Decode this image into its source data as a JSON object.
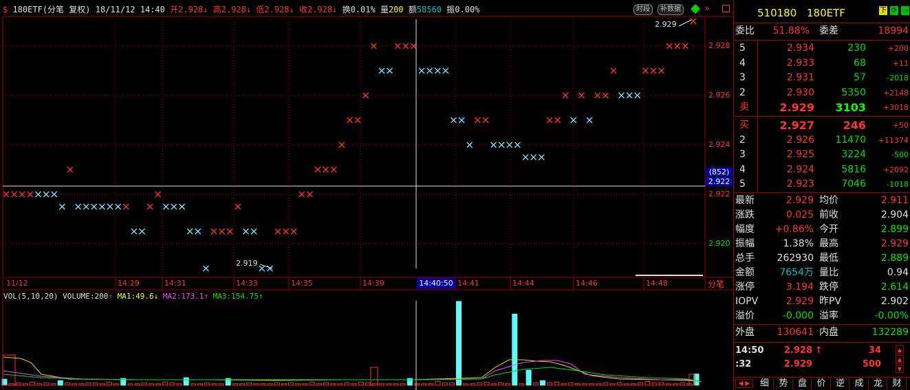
{
  "header": {
    "symbol_name": "180ETF(分笔 复权)",
    "datetime": "18/11/12 14:40",
    "open_label": "开",
    "open_value": "2.928",
    "high_label": "高",
    "high_value": "2.928",
    "low_label": "低",
    "low_value": "2.928",
    "close_label": "收",
    "close_value": "2.928",
    "turnover_label": "换",
    "turnover_value": "0.01%",
    "volume_label": "量",
    "volume_value": "200",
    "amount_label": "额",
    "amount_value": "58560",
    "amplitude_label": "振",
    "amplitude_value": "0.00%",
    "btn_timeshare": "时段",
    "btn_supplement": "补数据"
  },
  "price_axis": [
    "2.928",
    "2.926",
    "2.924",
    "2.922",
    "2.920"
  ],
  "crosshair": {
    "count_label": "(852)",
    "price_label": "2.922",
    "time_label": "14:40:50"
  },
  "annotations": {
    "high_label": "2.929",
    "low_label": "2.919"
  },
  "time_axis": [
    "11/12",
    "14:29",
    "14:31",
    "14:33",
    "14:35",
    "14:39",
    "14:41",
    "14:44",
    "14:46",
    "14:48"
  ],
  "tab_fenbi": "分笔",
  "volume_header": {
    "title": "VOL(5,10,20)",
    "volume": "VOLUME:200",
    "ma1": "MA1:49.6",
    "ma2": "MA2:173.1",
    "ma3": "MA3:154.75"
  },
  "colors": {
    "up": "#ff3232",
    "down": "#00e600",
    "cross_up": "#ff3232",
    "cross_down": "#80e0ff",
    "grid": "#a00000",
    "volume_bar": "#54ffff"
  },
  "ticks": [
    {
      "p": 2.922,
      "d": "u"
    },
    {
      "p": 2.922,
      "d": "u"
    },
    {
      "p": 2.922,
      "d": "u"
    },
    {
      "p": 2.922,
      "d": "u"
    },
    {
      "p": 2.922,
      "d": "d"
    },
    {
      "p": 2.922,
      "d": "d"
    },
    {
      "p": 2.922,
      "d": "d"
    },
    {
      "p": 2.9215,
      "d": "d"
    },
    {
      "p": 2.923,
      "d": "u"
    },
    {
      "p": 2.9215,
      "d": "d"
    },
    {
      "p": 2.9215,
      "d": "d"
    },
    {
      "p": 2.9215,
      "d": "d"
    },
    {
      "p": 2.9215,
      "d": "d"
    },
    {
      "p": 2.9215,
      "d": "d"
    },
    {
      "p": 2.9215,
      "d": "d"
    },
    {
      "p": 2.9215,
      "d": "u"
    },
    {
      "p": 2.9205,
      "d": "d"
    },
    {
      "p": 2.9205,
      "d": "d"
    },
    {
      "p": 2.9215,
      "d": "u"
    },
    {
      "p": 2.922,
      "d": "u"
    },
    {
      "p": 2.9215,
      "d": "d"
    },
    {
      "p": 2.9215,
      "d": "d"
    },
    {
      "p": 2.9215,
      "d": "d"
    },
    {
      "p": 2.9205,
      "d": "d"
    },
    {
      "p": 2.9205,
      "d": "d"
    },
    {
      "p": 2.919,
      "d": "d"
    },
    {
      "p": 2.9205,
      "d": "u"
    },
    {
      "p": 2.9205,
      "d": "u"
    },
    {
      "p": 2.9205,
      "d": "u"
    },
    {
      "p": 2.9215,
      "d": "u"
    },
    {
      "p": 2.9205,
      "d": "d"
    },
    {
      "p": 2.9205,
      "d": "d"
    },
    {
      "p": 2.919,
      "d": "d"
    },
    {
      "p": 2.919,
      "d": "d"
    },
    {
      "p": 2.9205,
      "d": "u"
    },
    {
      "p": 2.9205,
      "d": "u"
    },
    {
      "p": 2.9205,
      "d": "u"
    },
    {
      "p": 2.922,
      "d": "u"
    },
    {
      "p": 2.922,
      "d": "u"
    },
    {
      "p": 2.923,
      "d": "u"
    },
    {
      "p": 2.923,
      "d": "u"
    },
    {
      "p": 2.923,
      "d": "u"
    },
    {
      "p": 2.924,
      "d": "u"
    },
    {
      "p": 2.925,
      "d": "u"
    },
    {
      "p": 2.925,
      "d": "u"
    },
    {
      "p": 2.926,
      "d": "u"
    },
    {
      "p": 2.928,
      "d": "u"
    },
    {
      "p": 2.927,
      "d": "d"
    },
    {
      "p": 2.927,
      "d": "d"
    },
    {
      "p": 2.928,
      "d": "u"
    },
    {
      "p": 2.928,
      "d": "u"
    },
    {
      "p": 2.928,
      "d": "u"
    },
    {
      "p": 2.927,
      "d": "d"
    },
    {
      "p": 2.927,
      "d": "d"
    },
    {
      "p": 2.927,
      "d": "d"
    },
    {
      "p": 2.927,
      "d": "d"
    },
    {
      "p": 2.925,
      "d": "d"
    },
    {
      "p": 2.925,
      "d": "d"
    },
    {
      "p": 2.924,
      "d": "d"
    },
    {
      "p": 2.925,
      "d": "u"
    },
    {
      "p": 2.925,
      "d": "u"
    },
    {
      "p": 2.924,
      "d": "d"
    },
    {
      "p": 2.924,
      "d": "d"
    },
    {
      "p": 2.924,
      "d": "d"
    },
    {
      "p": 2.924,
      "d": "d"
    },
    {
      "p": 2.9235,
      "d": "d"
    },
    {
      "p": 2.9235,
      "d": "d"
    },
    {
      "p": 2.9235,
      "d": "d"
    },
    {
      "p": 2.925,
      "d": "u"
    },
    {
      "p": 2.925,
      "d": "u"
    },
    {
      "p": 2.926,
      "d": "u"
    },
    {
      "p": 2.925,
      "d": "d"
    },
    {
      "p": 2.926,
      "d": "u"
    },
    {
      "p": 2.925,
      "d": "d"
    },
    {
      "p": 2.926,
      "d": "u"
    },
    {
      "p": 2.926,
      "d": "u"
    },
    {
      "p": 2.927,
      "d": "u"
    },
    {
      "p": 2.926,
      "d": "d"
    },
    {
      "p": 2.926,
      "d": "d"
    },
    {
      "p": 2.926,
      "d": "d"
    },
    {
      "p": 2.927,
      "d": "u"
    },
    {
      "p": 2.927,
      "d": "u"
    },
    {
      "p": 2.927,
      "d": "u"
    },
    {
      "p": 2.928,
      "d": "u"
    },
    {
      "p": 2.928,
      "d": "u"
    },
    {
      "p": 2.928,
      "d": "u"
    },
    {
      "p": 2.929,
      "d": "u"
    }
  ],
  "volume_bars": [
    8,
    2,
    3,
    2,
    4,
    2,
    3,
    2,
    6,
    3,
    2,
    2,
    3,
    3,
    2,
    4,
    2,
    9,
    2,
    2,
    3,
    2,
    2,
    4,
    3,
    2,
    10,
    2,
    2,
    3,
    2,
    2,
    9,
    2,
    2,
    3,
    2,
    2,
    2,
    3,
    2,
    3,
    2,
    2,
    4,
    2,
    3,
    2,
    2,
    3,
    2,
    4,
    3,
    2,
    2,
    2,
    2,
    2,
    9,
    2,
    2,
    2,
    5,
    3,
    3,
    112,
    2,
    2,
    3,
    4,
    2,
    3,
    2,
    95,
    2,
    20,
    3,
    6,
    3,
    4,
    2,
    3,
    2,
    2,
    2,
    2,
    3,
    2,
    3,
    2,
    2,
    3,
    5,
    3,
    3,
    2,
    2,
    3,
    2,
    15
  ],
  "quote": {
    "code": "510180",
    "name": "180ETF",
    "weibi_label": "委比",
    "weibi_value": "51.88%",
    "weicha_label": "委差",
    "weicha_value": "18994",
    "asks": [
      {
        "lvl": "5",
        "price": "2.934",
        "vol": "230",
        "chg": "+200"
      },
      {
        "lvl": "4",
        "price": "2.933",
        "vol": "68",
        "chg": "+11"
      },
      {
        "lvl": "3",
        "price": "2.931",
        "vol": "57",
        "chg": "-2018"
      },
      {
        "lvl": "2",
        "price": "2.930",
        "vol": "5350",
        "chg": "+2148"
      },
      {
        "lvl": "卖",
        "price": "2.929",
        "vol": "3103",
        "chg": "+3018"
      }
    ],
    "bids": [
      {
        "lvl": "买",
        "price": "2.927",
        "vol": "246",
        "chg": "+50"
      },
      {
        "lvl": "2",
        "price": "2.926",
        "vol": "11470",
        "chg": "+11374"
      },
      {
        "lvl": "3",
        "price": "2.925",
        "vol": "3224",
        "chg": "-500"
      },
      {
        "lvl": "4",
        "price": "2.924",
        "vol": "5816",
        "chg": "+2092"
      },
      {
        "lvl": "5",
        "price": "2.923",
        "vol": "7046",
        "chg": "-1018"
      }
    ],
    "stats": [
      {
        "l1": "最新",
        "v1": "2.929",
        "c1": "up",
        "l2": "均价",
        "v2": "2.911",
        "c2": "up"
      },
      {
        "l1": "涨跌",
        "v1": "0.025",
        "c1": "up",
        "l2": "前收",
        "v2": "2.904",
        "c2": "wh"
      },
      {
        "l1": "幅度",
        "v1": "+0.86%",
        "c1": "up",
        "l2": "今开",
        "v2": "2.899",
        "c2": "dn"
      },
      {
        "l1": "振幅",
        "v1": "1.38%",
        "c1": "wh",
        "l2": "最高",
        "v2": "2.929",
        "c2": "up"
      },
      {
        "l1": "总手",
        "v1": "262930",
        "c1": "wh",
        "l2": "最低",
        "v2": "2.889",
        "c2": "dn"
      },
      {
        "l1": "金额",
        "v1": "7654万",
        "c1": "cy",
        "l2": "量比",
        "v2": "0.94",
        "c2": "wh"
      },
      {
        "l1": "涨停",
        "v1": "3.194",
        "c1": "up",
        "l2": "跌停",
        "v2": "2.614",
        "c2": "dn"
      },
      {
        "l1": "IOPV",
        "v1": "2.929",
        "c1": "up",
        "l2": "昨PV",
        "v2": "2.902",
        "c2": "wh"
      },
      {
        "l1": "溢价",
        "v1": "-0.000",
        "c1": "dn",
        "l2": "溢率",
        "v2": "-0.00%",
        "c2": "dn"
      }
    ],
    "waipan_label": "外盘",
    "waipan_value": "130641",
    "neipan_label": "内盘",
    "neipan_value": "132289",
    "trades": [
      {
        "time": "14:50",
        "price": "2.928",
        "arrow": "↑",
        "vol": "34"
      },
      {
        "time": ":32",
        "price": "2.929",
        "arrow": "",
        "vol": "500"
      }
    ],
    "bottom_tabs": [
      "细",
      "势",
      "盘",
      "价",
      "逆",
      "成",
      "龙",
      "财"
    ]
  }
}
